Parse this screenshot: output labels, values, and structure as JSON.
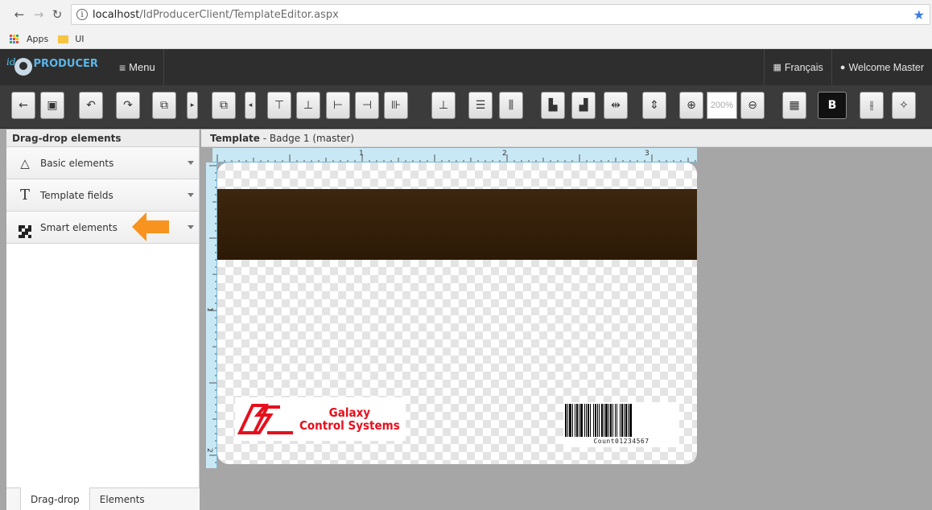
{
  "browser": {
    "back_icon": "arrow-left-icon",
    "url_host": "localhost",
    "url_path": "/IdProducerClient/TemplateEditor.aspx",
    "bookmarks": [
      {
        "label": "Apps",
        "icon": "apps-grid-icon"
      },
      {
        "label": "UI",
        "icon": "folder-icon"
      }
    ]
  },
  "header": {
    "logo_prefix": "id",
    "logo_text": "PRODUCER",
    "menu_label": "Menu",
    "language_label": "Français",
    "welcome_label": "Welcome Master"
  },
  "toolbar": {
    "zoom_level": "200%",
    "bold_label": "B"
  },
  "left_panel": {
    "title": "Drag-drop elements",
    "items": [
      {
        "label": "Basic elements",
        "icon": "shapes-icon"
      },
      {
        "label": "Template fields",
        "icon": "text-field-icon",
        "icon_glyph": "T"
      },
      {
        "label": "Smart elements",
        "icon": "qr-code-icon"
      }
    ],
    "tabs": [
      {
        "label": "Drag-drop",
        "active": true
      },
      {
        "label": "Elements",
        "active": false
      }
    ]
  },
  "template": {
    "title_bold": "Template",
    "title_rest": " - Badge 1 (master)",
    "ruler_top_numbers": [
      "1",
      "2",
      "3"
    ],
    "ruler_left_numbers": [
      "1",
      "2"
    ],
    "logo_line1": "Galaxy",
    "logo_line2": "Control Systems",
    "barcode_text": "Count01234567"
  },
  "colors": {
    "header_bg": "#2e2e2e",
    "toolbar_bg": "#3b3b3b",
    "accent_arrow": "#f7931e",
    "logo_red": "#e5101d",
    "stripe": "#3d260f"
  }
}
